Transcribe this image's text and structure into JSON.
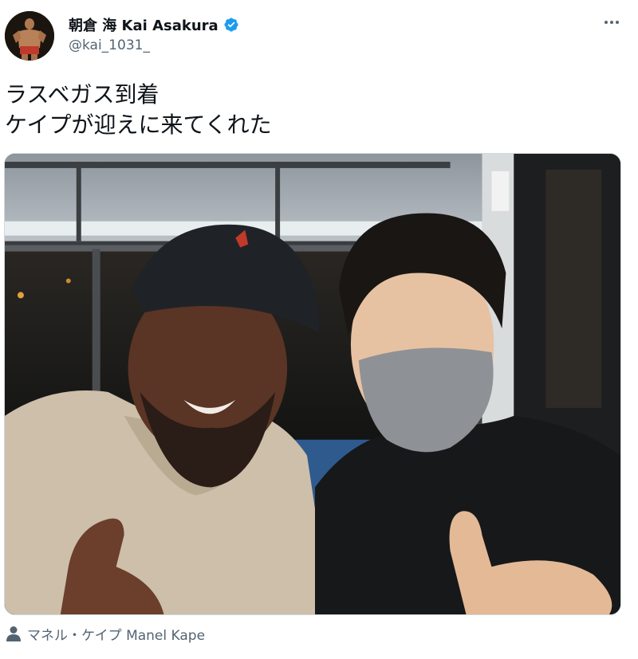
{
  "author": {
    "display_name": "朝倉 海 Kai Asakura",
    "handle": "@kai_1031_",
    "verified": true,
    "avatar_icon": "fighter-avatar"
  },
  "tweet": {
    "lines": [
      "ラスベガス到着",
      "ケイプが迎えに来てくれた"
    ]
  },
  "media": {
    "type": "photo",
    "subject": "selfie-on-bus"
  },
  "tagged": {
    "icon": "person-icon",
    "label": "マネル・ケイプ Manel Kape"
  },
  "colors": {
    "verified_blue": "#1d9bf0",
    "secondary_text": "#536471",
    "primary_text": "#0f1419"
  }
}
